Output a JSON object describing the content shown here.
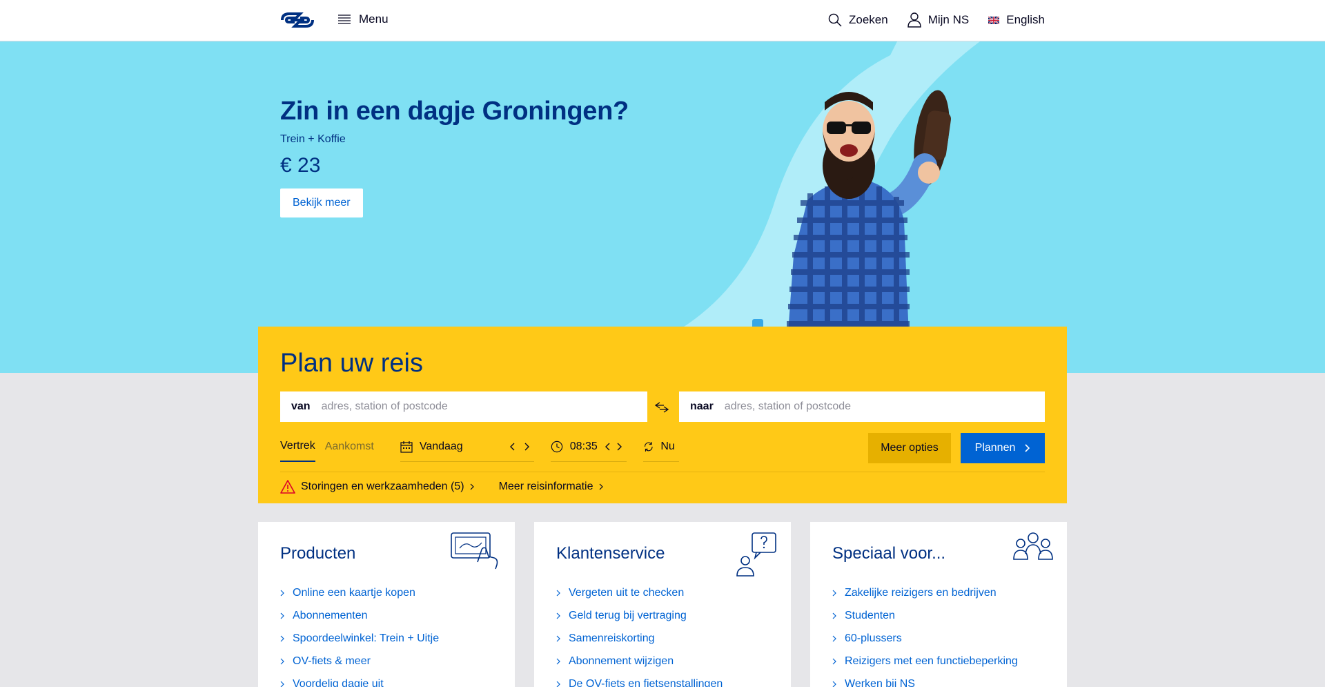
{
  "header": {
    "menu_label": "Menu",
    "search_label": "Zoeken",
    "account_label": "Mijn NS",
    "language_label": "English"
  },
  "hero": {
    "title": "Zin in een dagje Groningen?",
    "subtitle": "Trein + Koffie",
    "price": "€ 23",
    "button_label": "Bekijk meer"
  },
  "planner": {
    "title": "Plan uw reis",
    "from_label": "van",
    "from_placeholder": "adres, station of postcode",
    "to_label": "naar",
    "to_placeholder": "adres, station of postcode",
    "tab_departure": "Vertrek",
    "tab_arrival": "Aankomst",
    "date_value": "Vandaag",
    "time_value": "08:35",
    "now_label": "Nu",
    "more_options_label": "Meer opties",
    "plan_button_label": "Plannen",
    "disruptions_link": "Storingen en werkzaamheden (5)",
    "travel_info_link": "Meer reisinformatie"
  },
  "cards": [
    {
      "title": "Producten",
      "links": [
        "Online een kaartje kopen",
        "Abonnementen",
        "Spoordeelwinkel: Trein + Uitje",
        "OV-fiets & meer",
        "Voordelig dagje uit"
      ]
    },
    {
      "title": "Klantenservice",
      "links": [
        "Vergeten uit te checken",
        "Geld terug bij vertraging",
        "Samenreiskorting",
        "Abonnement wijzigen",
        "De OV-fiets en fietsenstallingen"
      ]
    },
    {
      "title": "Speciaal voor...",
      "links": [
        "Zakelijke reizigers en bedrijven",
        "Studenten",
        "60-plussers",
        "Reizigers met een functiebeperking",
        "Werken bij NS"
      ]
    }
  ],
  "colors": {
    "ns_blue": "#003082",
    "link_blue": "#0063d3",
    "ns_yellow": "#ffc917",
    "hero_cyan": "#7fe0f3",
    "warning_red": "#db0029"
  },
  "icons": [
    "ns-logo",
    "hamburger-icon",
    "search-icon",
    "user-icon",
    "uk-flag-icon",
    "swap-arrows-icon",
    "calendar-icon",
    "clock-icon",
    "refresh-icon",
    "warning-icon",
    "chevron-right-icon",
    "chevron-left-icon",
    "ticket-hand-icon",
    "question-person-icon",
    "group-icon"
  ]
}
